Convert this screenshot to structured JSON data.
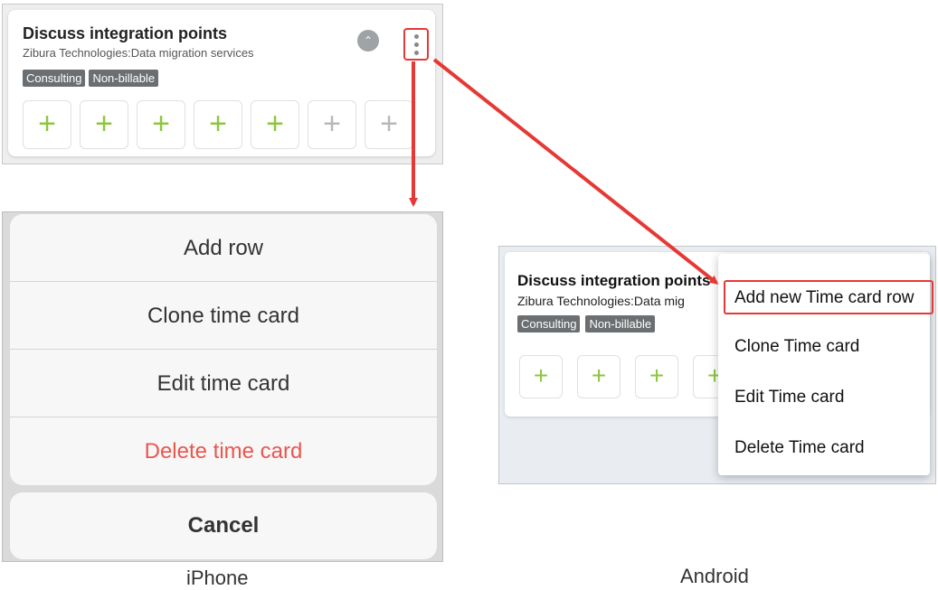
{
  "card": {
    "title": "Discuss integration points",
    "subtitle": "Zibura Technologies:Data migration services",
    "tags": [
      "Consulting",
      "Non-billable"
    ],
    "collapse_icon": "chevron-double-up-icon",
    "menu_icon": "kebab-menu-icon",
    "plus_glyph": "+"
  },
  "iphone": {
    "actions": [
      "Add row",
      "Clone time card",
      "Edit time card",
      "Delete time card"
    ],
    "cancel": "Cancel",
    "caption": "iPhone"
  },
  "android": {
    "card_title": "Discuss integration points",
    "card_subtitle": "Zibura Technologies:Data mig",
    "tags": [
      "Consulting",
      "Non-billable"
    ],
    "menu": [
      "Add new Time card row",
      "Clone Time card",
      "Edit Time card",
      "Delete Time card"
    ],
    "caption": "Android"
  },
  "colors": {
    "accent_plus": "#8dc63f",
    "highlight": "#e53935",
    "danger": "#e8574f"
  }
}
